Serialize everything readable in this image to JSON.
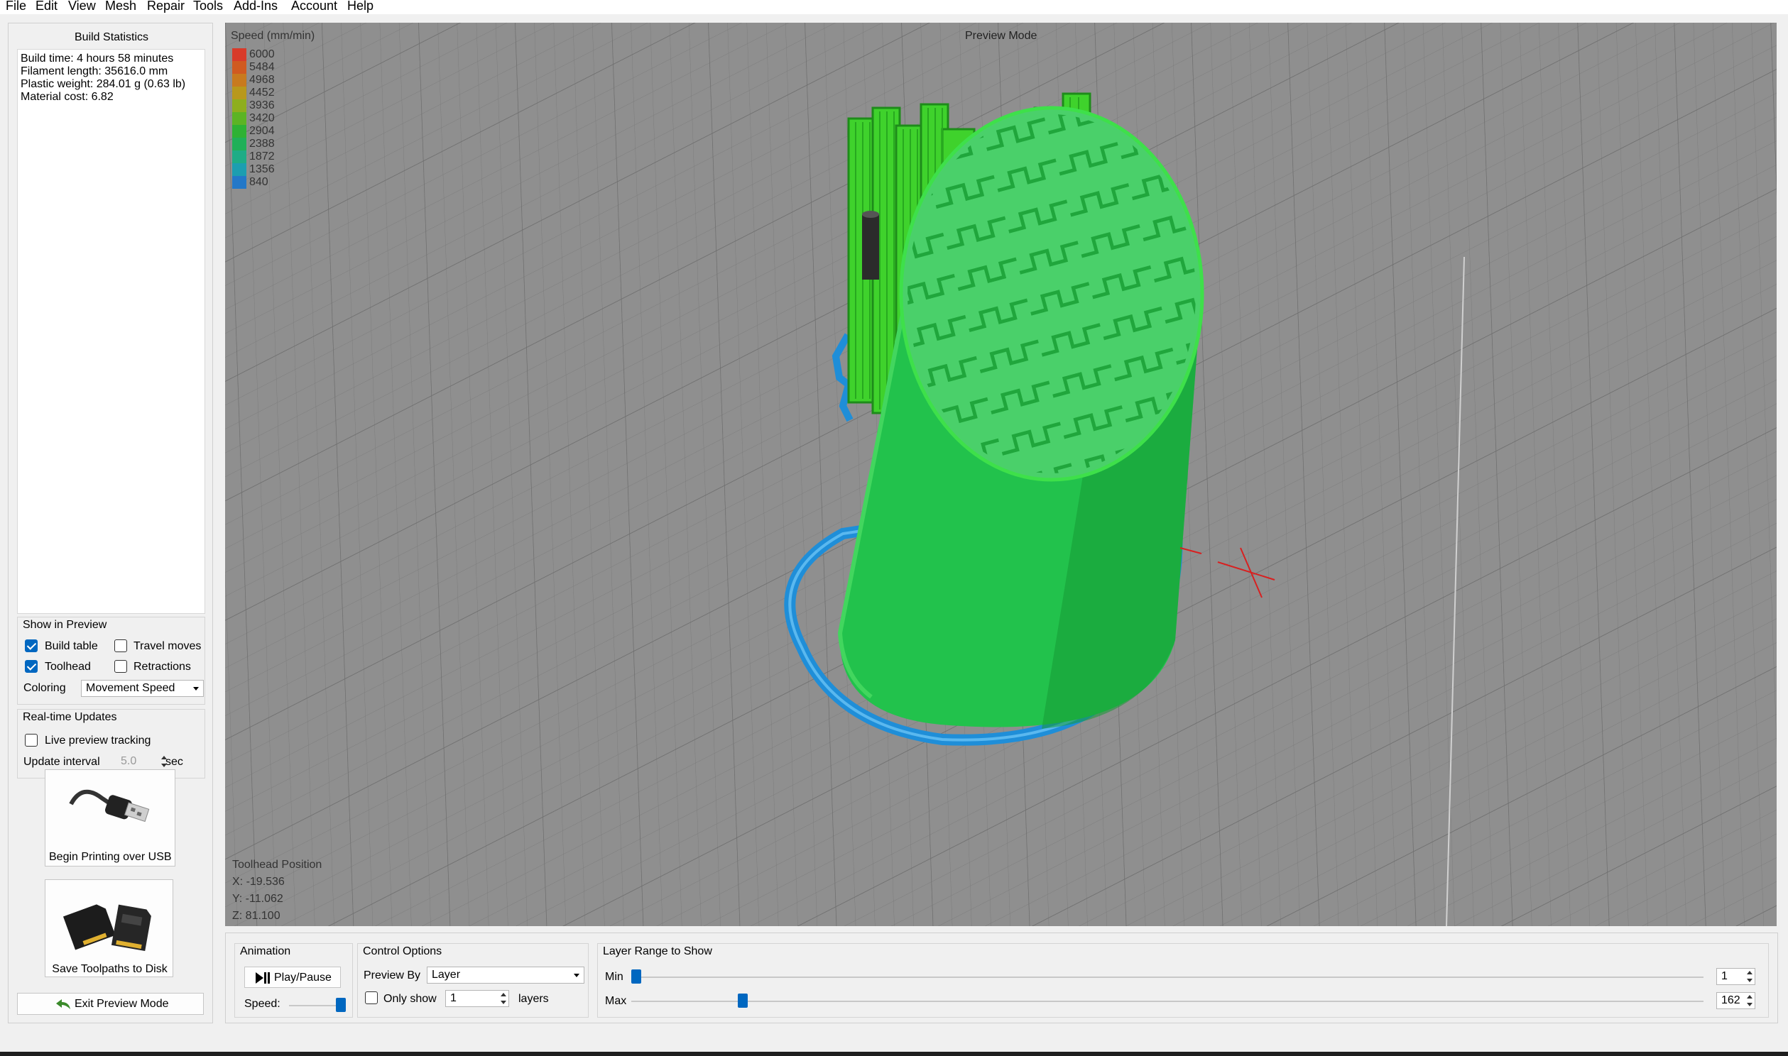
{
  "menu": [
    "File",
    "Edit",
    "View",
    "Mesh",
    "Repair",
    "Tools",
    "Add-Ins",
    "Account",
    "Help"
  ],
  "build_stats": {
    "title": "Build Statistics",
    "lines": [
      "Build time: 4 hours 58 minutes",
      "Filament length: 35616.0 mm",
      "Plastic weight: 284.01 g (0.63 lb)",
      "Material cost: 6.82"
    ]
  },
  "show_in_preview": {
    "title": "Show in Preview",
    "build_table": {
      "label": "Build table",
      "checked": true
    },
    "travel_moves": {
      "label": "Travel moves",
      "checked": false
    },
    "toolhead": {
      "label": "Toolhead",
      "checked": true
    },
    "retractions": {
      "label": "Retractions",
      "checked": false
    },
    "coloring_label": "Coloring",
    "coloring_value": "Movement Speed"
  },
  "realtime": {
    "title": "Real-time Updates",
    "live_tracking": {
      "label": "Live preview tracking",
      "checked": false
    },
    "interval_label": "Update interval",
    "interval_value": "5.0",
    "interval_unit": "sec"
  },
  "usb_button": {
    "label": "Begin Printing over USB",
    "icon": "usb-cable-icon"
  },
  "sd_button": {
    "label": "Save Toolpaths to Disk",
    "icon": "sd-card-icon"
  },
  "exit_button": {
    "label": "Exit Preview Mode",
    "icon": "back-arrow-icon"
  },
  "viewport": {
    "mode_label": "Preview Mode",
    "legend_title": "Speed (mm/min)",
    "legend": [
      {
        "value": "6000",
        "color": "#d83a2a"
      },
      {
        "value": "5484",
        "color": "#d05a20"
      },
      {
        "value": "4968",
        "color": "#c87a1e"
      },
      {
        "value": "4452",
        "color": "#b8981c"
      },
      {
        "value": "3936",
        "color": "#8eae1e"
      },
      {
        "value": "3420",
        "color": "#5cb424"
      },
      {
        "value": "2904",
        "color": "#2eb234"
      },
      {
        "value": "2388",
        "color": "#20b058"
      },
      {
        "value": "1872",
        "color": "#1eac86"
      },
      {
        "value": "1356",
        "color": "#1c9eb0"
      },
      {
        "value": "840",
        "color": "#2378c8"
      }
    ],
    "toolhead_title": "Toolhead Position",
    "toolhead_x": "X: -19.536",
    "toolhead_y": "Y: -11.062",
    "toolhead_z": "Z: 81.100"
  },
  "animation": {
    "title": "Animation",
    "play_label": "Play/Pause",
    "speed_label": "Speed:",
    "speed_fraction": 1.0
  },
  "control_options": {
    "title": "Control Options",
    "preview_by_label": "Preview By",
    "preview_by_value": "Layer",
    "only_show_label": "Only show",
    "only_show_checked": false,
    "only_show_value": "1",
    "layers_label": "layers"
  },
  "layer_range": {
    "title": "Layer Range to Show",
    "min_label": "Min",
    "max_label": "Max",
    "min_value": "1",
    "max_value": "162",
    "min_fraction": 0.0,
    "max_fraction": 0.1
  }
}
